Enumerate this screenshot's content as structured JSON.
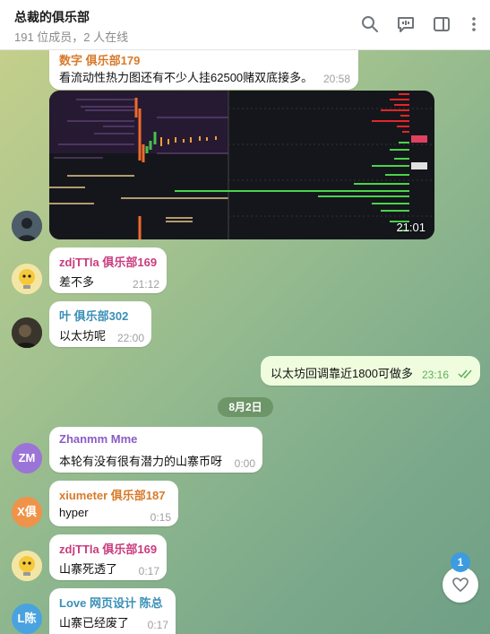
{
  "header": {
    "title": "总裁的俱乐部",
    "subtitle": "191 位成员，2 人在线"
  },
  "messages": [
    {
      "sender": "数字 俱乐部179",
      "text": "看流动性热力图还有不少人挂62500赌双底接多。",
      "time": "20:58",
      "color": "#d87a2a"
    },
    {
      "media_time": "21:01"
    },
    {
      "sender": "zdjTTla 俱乐部169",
      "text": "差不多",
      "time": "21:12",
      "color": "#c93c7e"
    },
    {
      "sender": "叶 俱乐部302",
      "text": "以太坊呢",
      "time": "22:00",
      "color": "#3a8fb7"
    },
    {
      "text": "以太坊回调靠近1800可做多",
      "time": "23:16"
    },
    {
      "date": "8月2日"
    },
    {
      "sender": "Zhanmm Mme",
      "text": "本轮有没有很有潜力的山寨币呀",
      "time": "0:00",
      "color": "#8a5cc7",
      "avatar": "ZM",
      "avatar_color": "#9b74d8"
    },
    {
      "sender": "xiumeter 俱乐部187",
      "text": "hyper",
      "time": "0:15",
      "color": "#d87a2a",
      "avatar": "X俱",
      "avatar_color": "#f0934a"
    },
    {
      "sender": "zdjTTla 俱乐部169",
      "text": "山寨死透了",
      "time": "0:17",
      "color": "#c93c7e"
    },
    {
      "sender": "Love 网页设计 陈总",
      "text": "山寨已经废了",
      "time": "0:17",
      "color": "#3a8fb7",
      "avatar": "L陈",
      "avatar_color": "#4aa3df"
    }
  ],
  "reaction_count": "1"
}
